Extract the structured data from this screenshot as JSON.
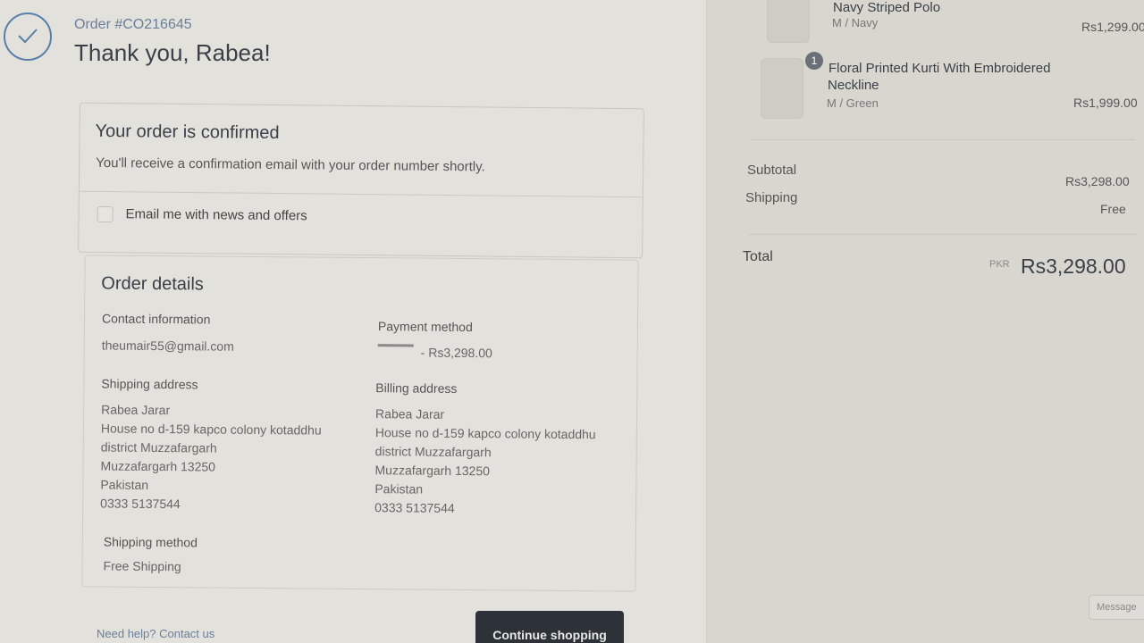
{
  "header": {
    "order_number": "Order #CO216645",
    "thank_you": "Thank you, Rabea!"
  },
  "confirmation": {
    "title": "Your order is confirmed",
    "message": "You'll receive a confirmation email with your order number shortly.",
    "newsletter_label": "Email me with news and offers",
    "newsletter_checked": false
  },
  "order_details": {
    "title": "Order details",
    "contact_label": "Contact information",
    "contact_email": "theumair55@gmail.com",
    "payment_label": "Payment method",
    "payment_amount": "- Rs3,298.00",
    "shipping_address_label": "Shipping address",
    "shipping_address": [
      "Rabea Jarar",
      "House no d-159 kapco colony kotaddhu",
      "district Muzzafargarh",
      "Muzzafargarh 13250",
      "Pakistan",
      "0333 5137544"
    ],
    "billing_address_label": "Billing address",
    "billing_address": [
      "Rabea Jarar",
      "House no d-159 kapco colony kotaddhu",
      "district Muzzafargarh",
      "Muzzafargarh 13250",
      "Pakistan",
      "0333 5137544"
    ],
    "shipping_method_label": "Shipping method",
    "shipping_method": "Free Shipping"
  },
  "footer": {
    "help_text": "Need help? Contact us",
    "continue_label": "Continue shopping"
  },
  "cart": {
    "items": [
      {
        "name": "Navy Striped Polo",
        "variant": "M / Navy",
        "price": "Rs1,299.00"
      },
      {
        "name_line1": "Floral Printed Kurti With Embroidered",
        "name_line2": "Neckline",
        "variant": "M / Green",
        "price": "Rs1,999.00",
        "quantity": "1"
      }
    ],
    "subtotal_label": "Subtotal",
    "subtotal_value": "Rs3,298.00",
    "shipping_label": "Shipping",
    "shipping_value": "Free",
    "total_label": "Total",
    "currency": "PKR",
    "total_value": "Rs3,298.00"
  },
  "chat": {
    "label": "Message"
  },
  "colors": {
    "accent": "#5a7fa8",
    "button_bg": "#2d3138"
  },
  "icons": {
    "confirmation": "checkmark-circle-icon"
  }
}
